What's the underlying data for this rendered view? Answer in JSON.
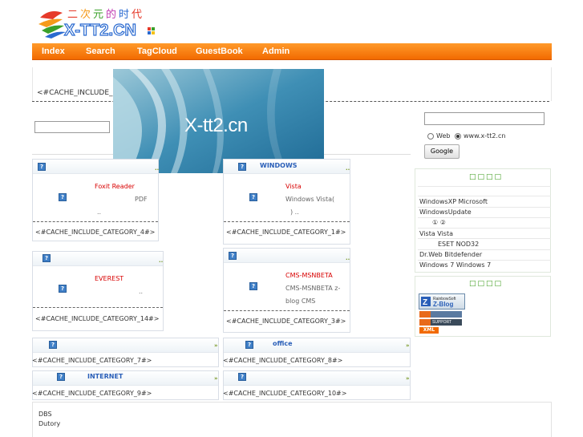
{
  "logo": {
    "text": "X-TT2.CN",
    "cjk_text": "二次元的时代"
  },
  "nav": {
    "items": [
      "Index",
      "Search",
      "TagCloud",
      "GuestBook",
      "Admin"
    ]
  },
  "tags_placeholder": "<#CACHE_INCLUDE_BFTAGS#>",
  "banner": {
    "text": "X-tt2.cn"
  },
  "search_box": {
    "web_label": "Web",
    "site_label": "www.x-tt2.cn",
    "button": "Google",
    "selected": "www.x-tt2.cn"
  },
  "sidebar": {
    "panel1_title": "□□□□",
    "lines": [
      "WindowsXP    Microsoft",
      "WindowsUpdate",
      "①          ②",
      "Vista           Vista",
      "ESET NOD32",
      "Dr.Web      Bitdefender",
      "Windows 7       Windows 7"
    ],
    "panel2_title": "□□□□",
    "badges": [
      "RainbowSoft Z-Blog",
      "XHTML",
      "WAP SUPPORT",
      "XML"
    ]
  },
  "boxes": {
    "b4": {
      "link": "Foxit Reader",
      "desc": "PDF",
      "dots": "..",
      "cat": "<#CACHE_INCLUDE_CATEGORY_4#>"
    },
    "b1": {
      "label": "WINDOWS",
      "link": "Vista",
      "desc1": "Windows Vista(",
      "desc2": ")      ..",
      "cat": "<#CACHE_INCLUDE_CATEGORY_1#>"
    },
    "b14": {
      "link": "EVEREST",
      "dots": "..",
      "cat": "<#CACHE_INCLUDE_CATEGORY_14#>"
    },
    "b3": {
      "link": "CMS-MSNBETA",
      "desc1": "CMS-MSNBETA  z-",
      "desc2": "blog CMS",
      "cat": "<#CACHE_INCLUDE_CATEGORY_3#>"
    },
    "b7": {
      "cat": "<#CACHE_INCLUDE_CATEGORY_7#>"
    },
    "b8": {
      "label": "office",
      "cat": "<#CACHE_INCLUDE_CATEGORY_8#>"
    },
    "b9": {
      "label": "INTERNET",
      "cat": "<#CACHE_INCLUDE_CATEGORY_9#>"
    },
    "b10": {
      "cat": "<#CACHE_INCLUDE_CATEGORY_10#>"
    }
  },
  "head_dots": "..",
  "head_dots2": "»",
  "footer": {
    "line1": "DBS",
    "line2": "Dutory"
  }
}
